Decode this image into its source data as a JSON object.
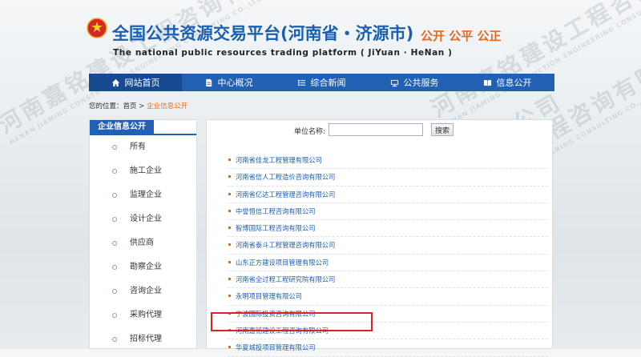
{
  "header": {
    "title": "全国公共资源交易平台(河南省・济源市)",
    "slogan": "公开 公平 公正",
    "subtitle": "The national public resources trading platform ( JiYuan · HeNan )"
  },
  "nav": [
    {
      "label": "网站首页",
      "icon": "home-icon"
    },
    {
      "label": "中心概况",
      "icon": "document-icon"
    },
    {
      "label": "综合新闻",
      "icon": "list-icon"
    },
    {
      "label": "公共服务",
      "icon": "monitor-icon"
    },
    {
      "label": "信息公开",
      "icon": "book-icon"
    }
  ],
  "breadcrumb": {
    "prefix": "您的位置：",
    "home": "首页",
    "sep": " > ",
    "current": "企业信息公开"
  },
  "sidebar": {
    "title": "企业信息公开",
    "items": [
      "所有",
      "施工企业",
      "监理企业",
      "设计企业",
      "供应商",
      "勘察企业",
      "咨询企业",
      "采购代理",
      "招标代理"
    ]
  },
  "search": {
    "label": "单位名称:",
    "value": "",
    "button": "搜索"
  },
  "companies": [
    "河南省佳龙工程管理有限公司",
    "河南省信人工程造价咨询有限公司",
    "河南省亿达工程管理咨询有限公司",
    "中誉恒信工程咨询有限公司",
    "智博国际工程咨询有限公司",
    "河南省泰斗工程管理咨询有限公司",
    "山东正方建设项目管理有限公司",
    "河南省全过程工程研究院有限公司",
    "永明项目管理有限公司",
    "宁波国际投资咨询有限公司",
    "河南嘉铭建设工程咨询有限公司",
    "华夏城投项目管理有限公司"
  ],
  "watermark": {
    "text": "河南嘉铭建设工程咨询有限公司",
    "en": "HENAN JIAMING CONSTRUCTION ENGINEERING CONSULTING CO.,LTD"
  },
  "colors": {
    "nav": "#2160b3",
    "accent": "#e8681a",
    "link": "#1b5fb0",
    "highlight": "#e02020"
  }
}
